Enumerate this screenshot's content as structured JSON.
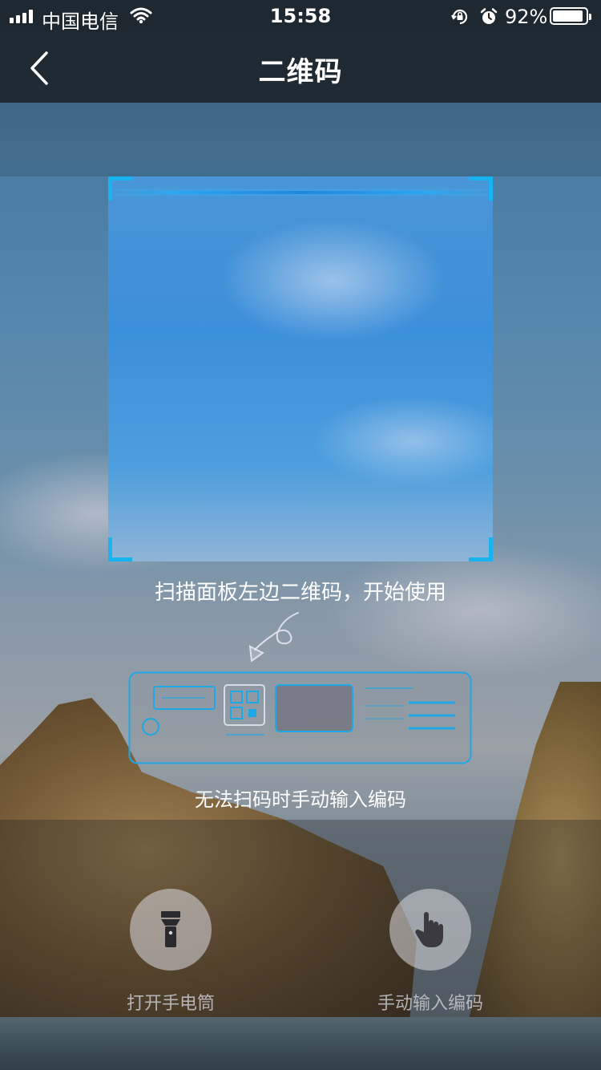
{
  "status_bar": {
    "carrier": "中国电信",
    "time": "15:58",
    "battery_percent": "92%",
    "battery_level": 0.92,
    "icons": [
      "signal-icon",
      "wifi-icon",
      "orientation-lock-icon",
      "alarm-icon",
      "battery-icon"
    ]
  },
  "nav": {
    "title": "二维码",
    "back_icon": "chevron-left-icon"
  },
  "scanner": {
    "hint": "扫描面板左边二维码，开始使用",
    "accent_color": "#18b4f2"
  },
  "manual": {
    "hint": "无法扫码时手动输入编码"
  },
  "actions": [
    {
      "label": "打开手电筒",
      "icon": "flashlight-icon"
    },
    {
      "label": "手动输入编码",
      "icon": "hand-pointer-icon"
    }
  ]
}
